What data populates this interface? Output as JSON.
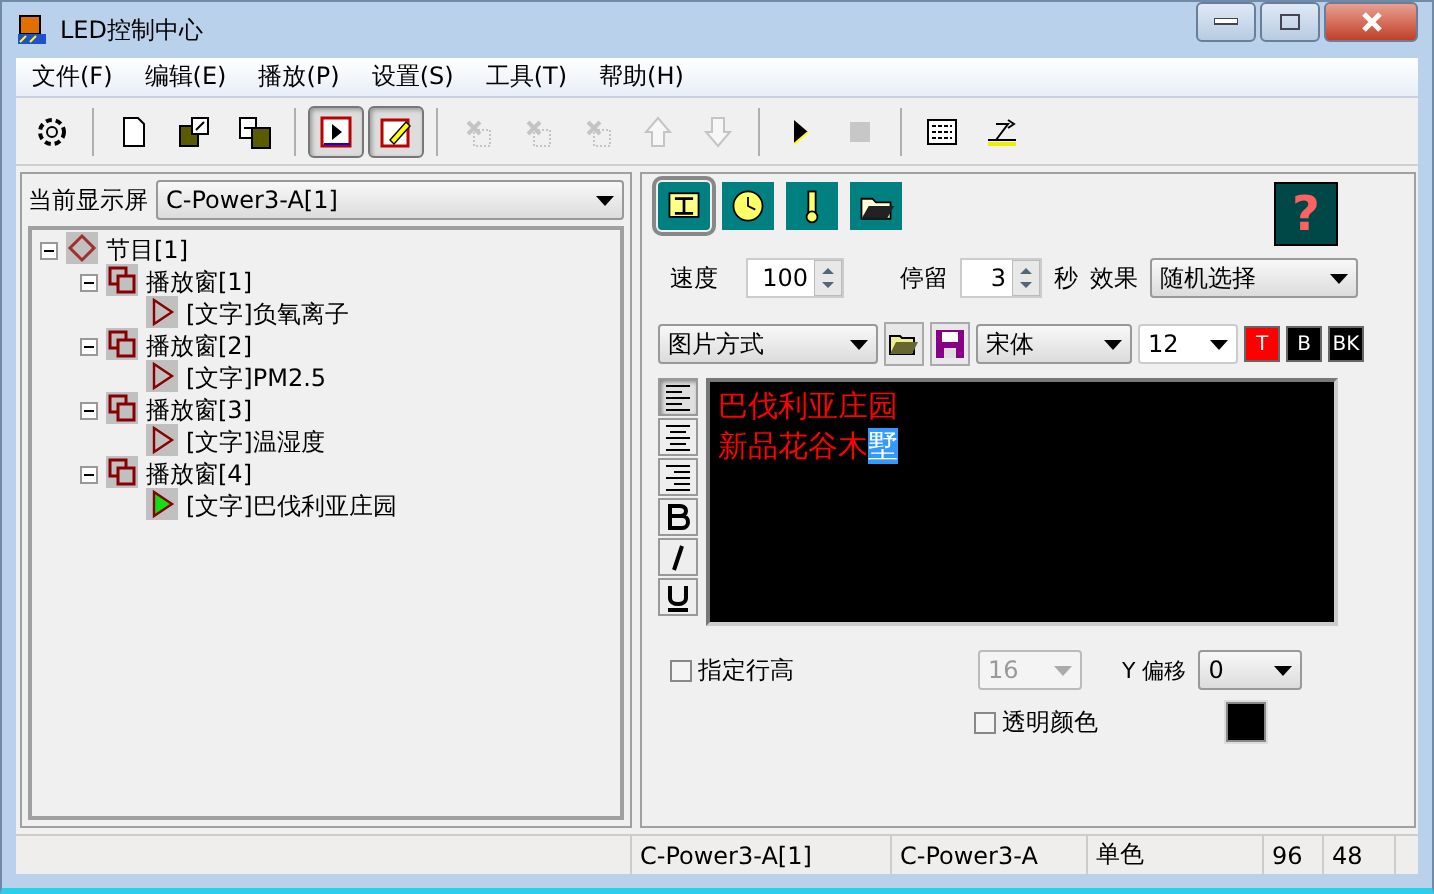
{
  "window": {
    "title": "LED控制中心"
  },
  "menu": [
    {
      "label": "文件(F)"
    },
    {
      "label": "编辑(E)"
    },
    {
      "label": "播放(P)"
    },
    {
      "label": "设置(S)"
    },
    {
      "label": "工具(T)"
    },
    {
      "label": "帮助(H)"
    }
  ],
  "toolbar": [
    {
      "kind": "gear",
      "pressed": false,
      "disabled": false,
      "group_start": false
    },
    {
      "kind": "new",
      "pressed": false,
      "disabled": false,
      "group_start": true
    },
    {
      "kind": "import",
      "pressed": false,
      "disabled": false,
      "group_start": false
    },
    {
      "kind": "export",
      "pressed": false,
      "disabled": false,
      "group_start": false
    },
    {
      "kind": "play-window",
      "pressed": true,
      "disabled": false,
      "group_start": true
    },
    {
      "kind": "edit",
      "pressed": true,
      "disabled": false,
      "group_start": false
    },
    {
      "kind": "add",
      "pressed": false,
      "disabled": true,
      "group_start": true
    },
    {
      "kind": "add-multi",
      "pressed": false,
      "disabled": true,
      "group_start": false
    },
    {
      "kind": "remove",
      "pressed": false,
      "disabled": true,
      "group_start": false
    },
    {
      "kind": "up",
      "pressed": false,
      "disabled": true,
      "group_start": false
    },
    {
      "kind": "down",
      "pressed": false,
      "disabled": true,
      "group_start": false
    },
    {
      "kind": "play",
      "pressed": false,
      "disabled": false,
      "group_start": true
    },
    {
      "kind": "stop",
      "pressed": false,
      "disabled": true,
      "group_start": false
    },
    {
      "kind": "panel",
      "pressed": false,
      "disabled": false,
      "group_start": true
    },
    {
      "kind": "send",
      "pressed": false,
      "disabled": false,
      "group_start": false
    }
  ],
  "screen_select": {
    "label": "当前显示屏",
    "value": "C-Power3-A[1]"
  },
  "tree": [
    {
      "kind": "program",
      "label": "节目[1]",
      "expanded": true,
      "active": false,
      "children": [
        {
          "kind": "window",
          "label": "播放窗[1]",
          "expanded": true,
          "active": false,
          "children": [
            {
              "kind": "text",
              "label": "[文字]负氧离子",
              "active": false
            }
          ]
        },
        {
          "kind": "window",
          "label": "播放窗[2]",
          "expanded": true,
          "active": false,
          "children": [
            {
              "kind": "text",
              "label": "[文字]PM2.5",
              "active": false
            }
          ]
        },
        {
          "kind": "window",
          "label": "播放窗[3]",
          "expanded": true,
          "active": false,
          "children": [
            {
              "kind": "text",
              "label": "[文字]温湿度",
              "active": false
            }
          ]
        },
        {
          "kind": "window",
          "label": "播放窗[4]",
          "expanded": true,
          "active": false,
          "children": [
            {
              "kind": "text",
              "label": "[文字]巴伐利亚庄园",
              "active": true
            }
          ]
        }
      ]
    }
  ],
  "content_tabs": [
    {
      "kind": "text",
      "selected": true
    },
    {
      "kind": "clock",
      "selected": false
    },
    {
      "kind": "thermometer",
      "selected": false
    },
    {
      "kind": "folder",
      "selected": false
    }
  ],
  "help_button": {
    "label": "?"
  },
  "speed": {
    "label": "速度",
    "value": "100"
  },
  "stay": {
    "label": "停留",
    "value": "3",
    "unit": "秒"
  },
  "effect": {
    "label": "效果",
    "value": "随机选择"
  },
  "mode": {
    "value": "图片方式"
  },
  "font": {
    "value": "宋体"
  },
  "font_size": {
    "value": "12"
  },
  "color_buttons": [
    {
      "label": "T",
      "color": "#ff0000"
    },
    {
      "label": "B",
      "color": "#000000"
    },
    {
      "label": "BK",
      "color": "#000000"
    }
  ],
  "format_buttons": [
    {
      "kind": "align-left",
      "pressed": true
    },
    {
      "kind": "align-center",
      "pressed": false
    },
    {
      "kind": "align-right",
      "pressed": false
    },
    {
      "kind": "bold",
      "pressed": false
    },
    {
      "kind": "italic",
      "pressed": false
    },
    {
      "kind": "underline",
      "pressed": false
    }
  ],
  "editor": {
    "lines": [
      {
        "text": "巴伐利亚庄园"
      },
      {
        "text": "新品花谷木",
        "selected_text": "墅"
      }
    ]
  },
  "line_height": {
    "label": "指定行高",
    "checked": false,
    "value": "16",
    "disabled": true
  },
  "y_offset": {
    "label": "Y 偏移",
    "value": "0"
  },
  "transparent": {
    "label": "透明颜色",
    "checked": false,
    "color": "#000000"
  },
  "status_bar": [
    "C-Power3-A[1]",
    "C-Power3-A",
    "单色",
    "96",
    "48"
  ]
}
